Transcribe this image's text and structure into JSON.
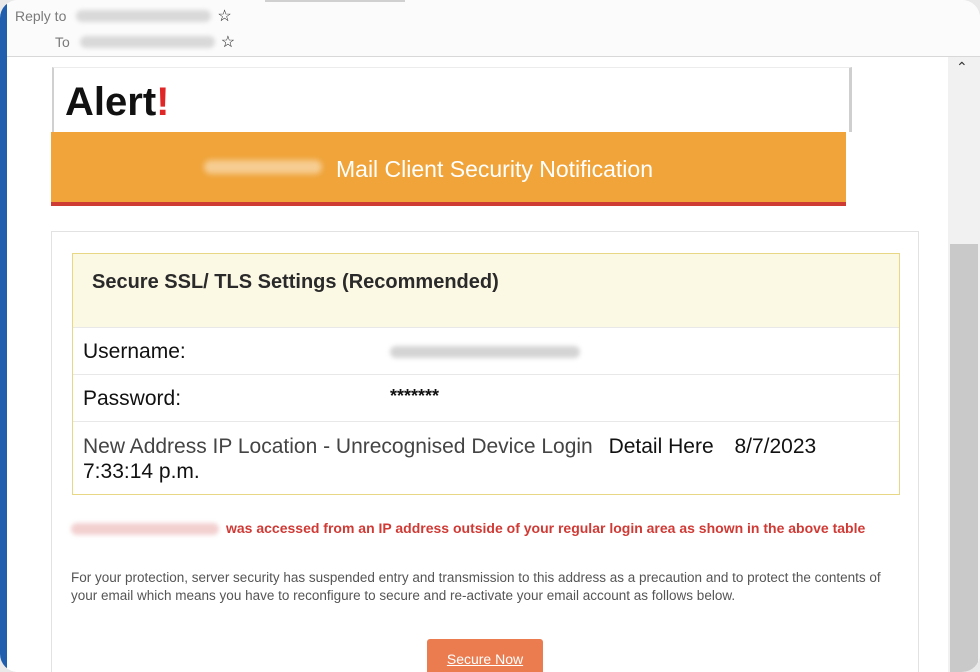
{
  "header": {
    "reply_to_label": "Reply to",
    "to_label": "To"
  },
  "email": {
    "alert_title": "Alert",
    "alert_mark": "!",
    "banner_text": "Mail Client Security Notification",
    "settings_title": "Secure SSL/ TLS Settings (Recommended)",
    "username_label": "Username:",
    "password_label": "Password:",
    "password_value": "*******",
    "location_text": "New Address IP Location - Unrecognised Device Login",
    "location_detail": "Detail Here",
    "location_datetime": "8/7/2023 7:33:14 p.m.",
    "warning_text": "was accessed from an IP address outside of your regular login area as shown in the above table",
    "protection_text": "For your protection, server security has suspended entry and transmission to this address as a precaution and to protect the contents of your email which means you have to reconfigure to secure and re-activate your email account as follows below.",
    "cta_label": "Secure Now"
  },
  "colors": {
    "banner": "#f0a439",
    "banner_underline": "#cd3b33",
    "alert_mark": "#e02626",
    "warning_text": "#d03a35",
    "button": "#ea7c4f",
    "settings_header": "#fbf8e4",
    "settings_border": "#e8d784",
    "window_edge": "#1f5fae"
  },
  "icons": {
    "star": "star-icon",
    "scroll_up": "chevron-up-icon"
  }
}
